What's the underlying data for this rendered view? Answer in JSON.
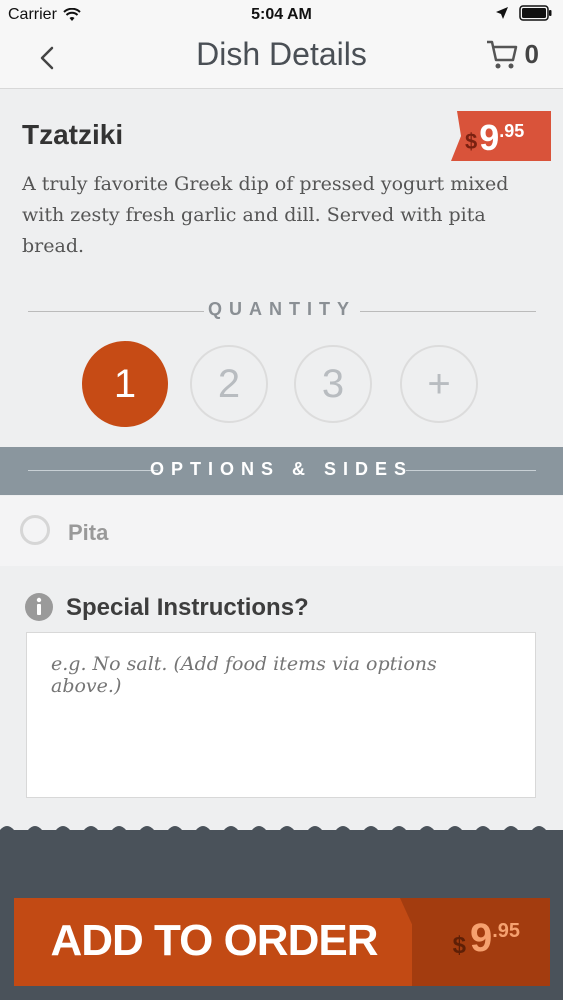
{
  "status": {
    "carrier": "Carrier",
    "time": "5:04 AM"
  },
  "nav": {
    "title": "Dish Details",
    "cart_count": "0"
  },
  "dish": {
    "name": "Tzatziki",
    "price": {
      "dollar": "$",
      "int": "9",
      "cents": ".95"
    },
    "description": "A truly favorite Greek dip of pressed yogurt mixed with zesty fresh garlic and dill.  Served with pita bread."
  },
  "quantity": {
    "label": "QUANTITY",
    "options": [
      "1",
      "2",
      "3",
      "+"
    ],
    "selected": "1"
  },
  "options": {
    "label": "OPTIONS & SIDES",
    "items": [
      {
        "label": "Pita",
        "selected": false
      }
    ]
  },
  "special": {
    "title": "Special Instructions?",
    "placeholder": "e.g. No salt. (Add food items via options above.)"
  },
  "footer": {
    "add_label": "ADD TO ORDER",
    "price": {
      "dollar": "$",
      "int": "9",
      "cents": ".95"
    }
  },
  "colors": {
    "accent": "#c64b15",
    "options_bar": "#8a969e",
    "footer": "#4a525a"
  }
}
